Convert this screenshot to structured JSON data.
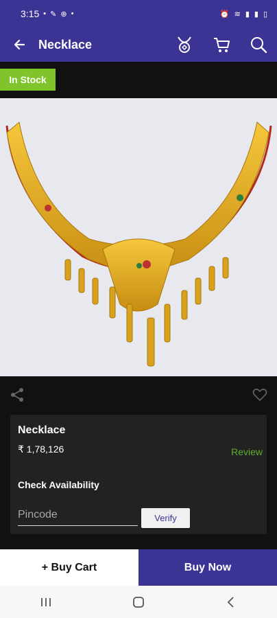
{
  "status_bar": {
    "time": "3:15",
    "left_icons": [
      "💬",
      "🔧",
      "⊕",
      "•"
    ],
    "right_icons": [
      "⏰",
      "wifi",
      "signal",
      "battery"
    ]
  },
  "app_bar": {
    "title": "Necklace",
    "icons": [
      "back-arrow",
      "jewelry-icon",
      "cart-icon",
      "search-icon"
    ]
  },
  "product": {
    "badge": "In Stock",
    "name": "Necklace",
    "price": "₹ 1,78,126",
    "review_label": "Review",
    "availability_label": "Check Availability",
    "pincode_placeholder": "Pincode",
    "verify_label": "Verify"
  },
  "actions": {
    "buy_cart": "+ Buy Cart",
    "buy_now": "Buy Now"
  },
  "colors": {
    "primary": "#3b3494",
    "accent_green": "#7fc42b",
    "review_green": "#5fae2c"
  }
}
